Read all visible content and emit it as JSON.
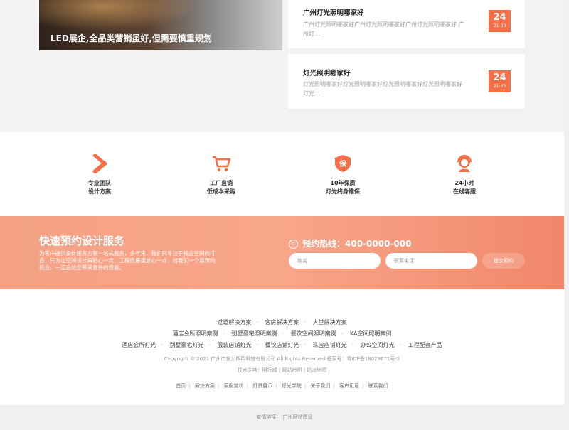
{
  "hero": {
    "caption": "LED展企,全品类营销虽好,但需要慎重规划"
  },
  "news_cards": [
    {
      "title": "广州灯光照明哪家好",
      "excerpt": "广州灯光照明哪家好广州灯光照明哪家好广州灯光照明哪家好 广州灯...",
      "day": "24",
      "month_year": "21-03"
    },
    {
      "title": "灯光照明哪家好",
      "excerpt": "灯光照明哪家好灯光照明哪家好灯光照明哪家好灯光照明哪家好 灯光...",
      "day": "24",
      "month_year": "21-03"
    }
  ],
  "features": [
    {
      "icon": "ruler-pencil-icon",
      "line1": "专业团队",
      "line2": "设计方案"
    },
    {
      "icon": "shopping-cart-icon",
      "line1": "工厂直销",
      "line2": "低成本采购"
    },
    {
      "icon": "shield-bao-icon",
      "line1": "10年保质",
      "line2": "灯光终身维保"
    },
    {
      "icon": "headset-agent-icon",
      "line1": "24小时",
      "line2": "在线客服"
    }
  ],
  "booking": {
    "title": "快速预约设计服务",
    "desc": "为客户提供设计服务方案一站式服务，多年来，我们只专注于精品空间的打造，只为让空间设计再贴心一点，工程质量更放心一点，给我们一个展示的机会，一定会给您带来意外的惊喜。",
    "hotline": "预约热线：400-0000-000",
    "name_placeholder": "姓名",
    "phone_placeholder": "联系电话",
    "submit": "提交预约"
  },
  "footer": {
    "row1": [
      "过道解决方案",
      "客房解决方案",
      "大堂解决方案"
    ],
    "row2": [
      "酒店会所照明案例",
      "别墅豪宅照明案例",
      "餐饮空间照明案例",
      "KA空间照明案例"
    ],
    "row3": [
      "酒店会所灯光",
      "别墅豪宅灯光",
      "服装店铺灯光",
      "餐饮店铺灯光",
      "珠宝店铺灯光",
      "办公空间灯光",
      "工程配套产品"
    ],
    "copyright": "Copyright © 2021 广州市友为照明科技有限公司 All Rights Reserved 备案号：粤ICP备18023671号-2",
    "support": "技术支持：明行威 | 网站地图 | 站点地图",
    "nav": [
      "首页",
      "解决方案",
      "案例赏析",
      "灯具展示",
      "灯光学院",
      "关于我们",
      "客户见证",
      "联系我们"
    ],
    "friend_links": "友情链接： 广州网站建设"
  },
  "colors": {
    "accent": "#f26f47",
    "booking_from": "#f4a185",
    "booking_to": "#f1876a"
  }
}
